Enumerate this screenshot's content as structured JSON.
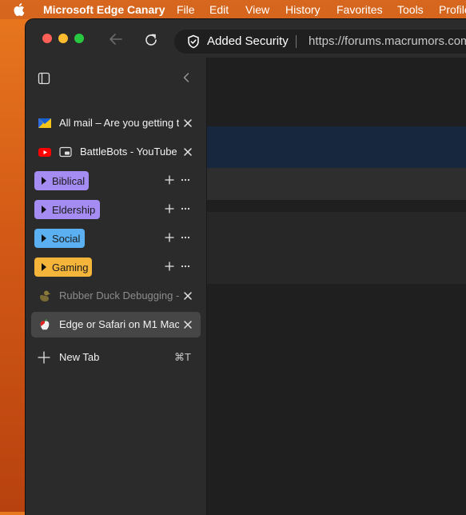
{
  "menubar": {
    "app_name": "Microsoft Edge Canary",
    "items": [
      "File",
      "Edit",
      "View",
      "History",
      "Favorites",
      "Tools",
      "Profile"
    ]
  },
  "toolbar": {
    "security_label": "Added Security",
    "url": "https://forums.macrumors.com"
  },
  "tabs": [
    {
      "title": "All mail – Are you getting the",
      "favicon": "mail-icon"
    },
    {
      "title": "BattleBots - YouTube",
      "favicon": "youtube-icon"
    },
    {
      "title": "Rubber Duck Debugging - ",
      "favicon": "duck-icon"
    },
    {
      "title": "Edge or Safari on M1 Mac",
      "favicon": "macrumors-icon"
    }
  ],
  "groups": [
    {
      "label": "Biblical",
      "color": "#a48cf2"
    },
    {
      "label": "Eldership",
      "color": "#a48cf2"
    },
    {
      "label": "Social",
      "color": "#5ab0f0"
    },
    {
      "label": "Gaming",
      "color": "#f5b43a"
    }
  ],
  "new_tab": {
    "label": "New Tab",
    "shortcut": "⌘T"
  },
  "colors": {
    "sidebar_bg": "#2b2b2b",
    "content_bg": "#1f1f1f",
    "active_tab": "#464646"
  }
}
